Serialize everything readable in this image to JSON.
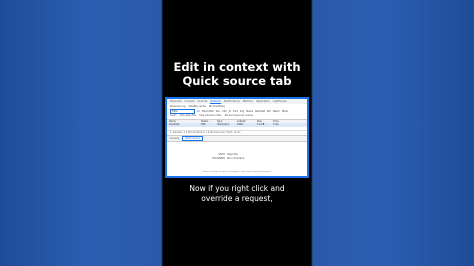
{
  "overlay": {
    "title_line1": "Edit in context with",
    "title_line2": "Quick source tab",
    "caption_line1": "Now if you right click and",
    "caption_line2": "override a request,"
  },
  "devtools": {
    "tabs": [
      "Elements",
      "Console",
      "Sources",
      "Network",
      "Performance",
      "Memory",
      "Application",
      "Lighthouse"
    ],
    "active_tab": 3,
    "toolbar": [
      "Preserve log",
      "Disable cache",
      "No throttling"
    ],
    "filter_placeholder": "Filter",
    "filter_types": [
      "All",
      "Fetch/XHR",
      "Doc",
      "CSS",
      "JS",
      "Font",
      "Img",
      "Media",
      "Manifest",
      "WS",
      "Wasm",
      "Other"
    ],
    "options": [
      "Invert",
      "Hide data URLs",
      "Hide extension URLs",
      "Blocked response cookies"
    ],
    "columns": [
      "Name",
      "Status",
      "Type",
      "Initiator",
      "Size",
      "Time"
    ],
    "rows": [
      {
        "name": "localhost",
        "status": "200",
        "type": "document",
        "initiator": "Other",
        "size": "1.0 kB",
        "time": "3 ms"
      }
    ],
    "status": "1 requests | 1.0 kB transferred | 1.0 kB resources | Finish: 10 ms",
    "drawer_tabs": [
      "Console",
      "Quick source"
    ],
    "drawer_active": 1,
    "shortcuts": [
      {
        "keys": "Ctrl P",
        "label": "Open file"
      },
      {
        "keys": "Ctrl Shift P",
        "label": "Run command"
      }
    ],
    "footer": "Drop in a folder to add to workspace. Learn more about workspaces"
  }
}
